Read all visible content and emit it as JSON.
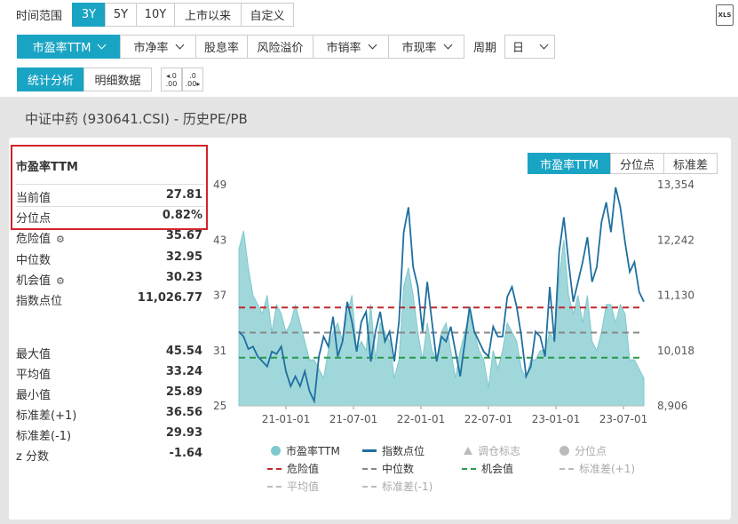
{
  "time_range": {
    "label": "时间范围",
    "options": [
      "3Y",
      "5Y",
      "10Y",
      "上市以来",
      "自定义"
    ],
    "active": "3Y"
  },
  "export_icon_label": "XLS",
  "metrics": {
    "items": [
      "市盈率TTM",
      "市净率",
      "股息率",
      "风险溢价",
      "市销率",
      "市现率"
    ],
    "active": "市盈率TTM",
    "period_label": "周期",
    "period_value": "日"
  },
  "view_tabs": [
    "统计分析",
    "明细数据"
  ],
  "decimal_buttons": [
    ".0 .00",
    ".0 .00"
  ],
  "page_title": "中证中药 (930641.CSI) - 历史PE/PB",
  "stats": {
    "header": "市盈率TTM",
    "current": {
      "label": "当前值",
      "value": "27.81"
    },
    "percentile": {
      "label": "分位点",
      "value": "0.82%"
    },
    "danger": {
      "label": "危险值",
      "value": "35.67"
    },
    "median": {
      "label": "中位数",
      "value": "32.95"
    },
    "opportunity": {
      "label": "机会值",
      "value": "30.23"
    },
    "index_points": {
      "label": "指数点位",
      "value": "11,026.77"
    },
    "max": {
      "label": "最大值",
      "value": "45.54"
    },
    "mean": {
      "label": "平均值",
      "value": "33.24"
    },
    "min": {
      "label": "最小值",
      "value": "25.89"
    },
    "std_plus": {
      "label": "标准差(+1)",
      "value": "36.56"
    },
    "std_minus": {
      "label": "标准差(-1)",
      "value": "29.93"
    },
    "z": {
      "label": "z 分数",
      "value": "-1.64"
    }
  },
  "chart_tabs": [
    "市盈率TTM",
    "分位点",
    "标准差"
  ],
  "chart_data": {
    "type": "area",
    "x_ticks": [
      "21-01-01",
      "21-07-01",
      "22-01-01",
      "22-07-01",
      "23-01-01",
      "23-07-01"
    ],
    "y_left_ticks": [
      "49",
      "43",
      "37",
      "31",
      "25"
    ],
    "y_left_range": [
      25,
      49
    ],
    "y_right_ticks": [
      "13,354",
      "12,242",
      "11,130",
      "10,018",
      "8,906"
    ],
    "y_right_range": [
      8906,
      13354
    ],
    "ref_lines": [
      {
        "name": "危险值",
        "value": 35.67,
        "color": "#c0282d"
      },
      {
        "name": "中位数",
        "value": 32.95,
        "color": "#888888"
      },
      {
        "name": "机会值",
        "value": 30.23,
        "color": "#2a9a4c"
      }
    ],
    "pe_series": [
      42,
      44,
      40,
      37,
      36,
      35,
      37,
      33,
      36,
      35,
      33,
      34,
      36,
      34,
      32,
      30,
      30,
      29,
      28,
      31,
      33,
      34,
      32,
      35,
      37,
      31,
      32,
      31,
      36,
      30,
      34,
      33,
      32,
      28,
      30,
      38,
      40,
      37,
      33,
      30,
      34,
      31,
      30,
      33,
      34,
      31,
      28,
      31,
      33,
      35,
      33,
      31,
      30,
      27,
      31,
      29,
      31,
      34,
      33,
      32,
      29,
      28,
      30,
      30,
      31,
      31,
      33,
      32,
      39,
      43,
      37,
      35,
      37,
      34,
      37,
      32,
      31,
      33,
      36,
      36,
      34,
      36,
      35,
      30,
      30,
      29,
      28
    ],
    "index_series": [
      10400,
      10300,
      10050,
      10100,
      9900,
      9800,
      9700,
      10000,
      9950,
      10100,
      9600,
      9300,
      9500,
      9300,
      9600,
      9200,
      9000,
      9900,
      10300,
      10100,
      10700,
      9900,
      10200,
      11000,
      10600,
      10000,
      10600,
      10800,
      9800,
      10400,
      10800,
      10200,
      10400,
      9800,
      10600,
      12400,
      12900,
      11700,
      11300,
      10400,
      11400,
      10600,
      9800,
      10300,
      10200,
      10500,
      10000,
      9500,
      10200,
      10900,
      10400,
      10200,
      10000,
      9900,
      10500,
      10300,
      10300,
      11100,
      11300,
      10900,
      10300,
      9500,
      9700,
      10400,
      10300,
      9900,
      11300,
      10200,
      12000,
      12700,
      11800,
      11000,
      11400,
      11800,
      12300,
      11400,
      11700,
      12600,
      13000,
      12400,
      13300,
      12900,
      12200,
      11600,
      11800,
      11200,
      11000
    ],
    "legend": [
      {
        "name": "市盈率TTM",
        "marker": "dot",
        "color": "#7ec9cc",
        "dim": false
      },
      {
        "name": "指数点位",
        "marker": "line",
        "color": "#1f6fa0",
        "dim": false
      },
      {
        "name": "调仓标志",
        "marker": "triangle",
        "color": "#bbbbbb",
        "dim": true
      },
      {
        "name": "分位点",
        "marker": "dot",
        "color": "#bbbbbb",
        "dim": true
      },
      {
        "name": "危险值",
        "marker": "dash",
        "color": "#c0282d",
        "dim": false
      },
      {
        "name": "中位数",
        "marker": "dash",
        "color": "#888888",
        "dim": false
      },
      {
        "name": "机会值",
        "marker": "dash",
        "color": "#2a9a4c",
        "dim": false
      },
      {
        "name": "标准差(+1)",
        "marker": "dash",
        "color": "#bbbbbb",
        "dim": true
      },
      {
        "name": "平均值",
        "marker": "dash",
        "color": "#bbbbbb",
        "dim": true
      },
      {
        "name": "标准差(-1)",
        "marker": "dash",
        "color": "#bbbbbb",
        "dim": true
      }
    ]
  }
}
